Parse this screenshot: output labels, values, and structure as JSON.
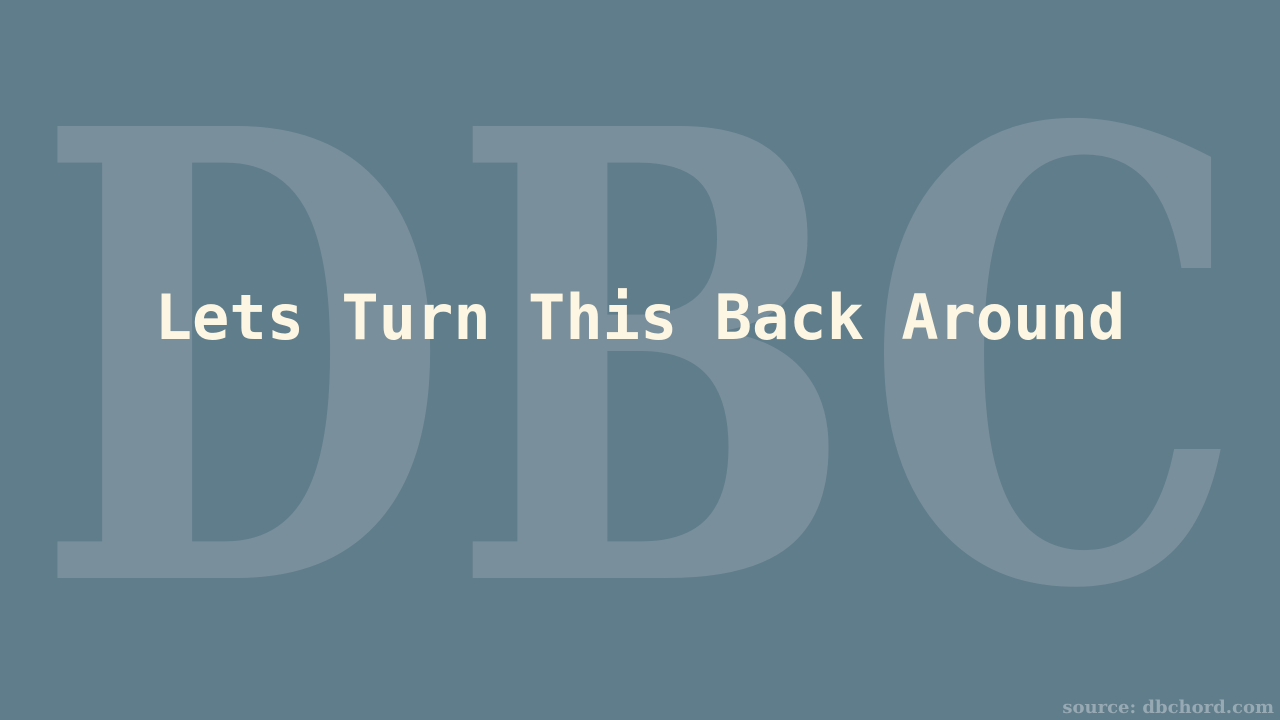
{
  "watermark": {
    "text": "DBC",
    "color": "#7a8f9c"
  },
  "title": "Lets Turn This Back Around",
  "source": "source: dbchord.com",
  "colors": {
    "background": "#607d8b",
    "title_text": "#fdf6e3",
    "source_text": "#97a9b3"
  }
}
